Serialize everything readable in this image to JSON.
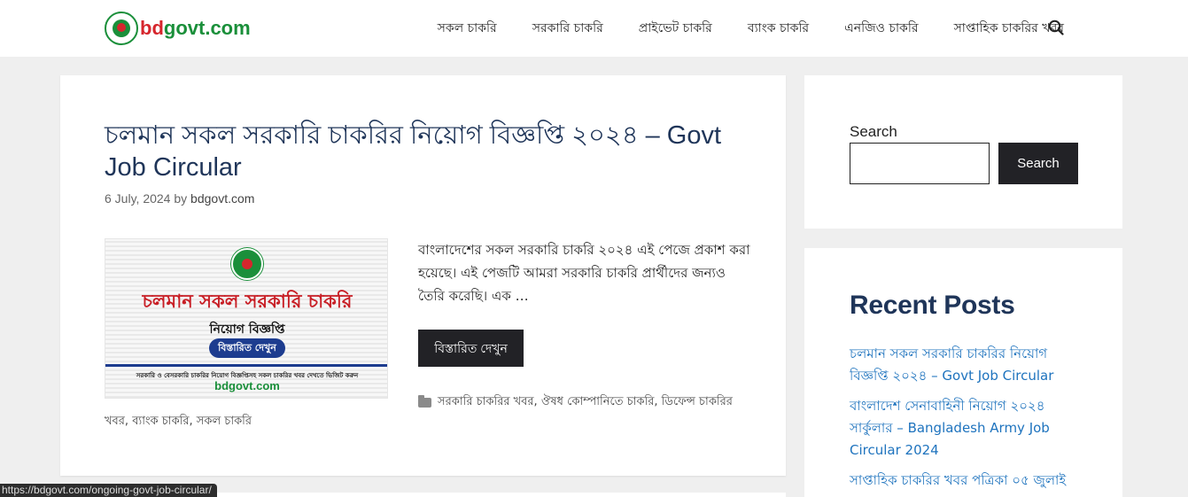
{
  "header": {
    "logo_text_a": "bd",
    "logo_text_b": "govt.com",
    "nav": [
      "সকল চাকরি",
      "সরকারি চাকরি",
      "প্রাইভেট চাকরি",
      "ব্যাংক চাকরি",
      "এনজিও চাকরি",
      "সাপ্তাহিক চাকরির খবর"
    ],
    "search_icon": "search-icon"
  },
  "post": {
    "title": "চলমান সকল সরকারি চাকরির নিয়োগ বিজ্ঞপ্তি ২০২৪ – Govt Job Circular",
    "date": "6 July, 2024",
    "by": "by",
    "author": "bdgovt.com",
    "thumbnail": {
      "title": "চলমান সকল সরকারি চাকরি",
      "subtitle": "নিয়োগ বিজ্ঞপ্তি",
      "button": "বিস্তারিত দেখুন",
      "footer": "সরকারি ও বেসরকারি চাকরির নিয়োগ বিজ্ঞপ্তিসহ সকল চাকরির খবর দেখতে ভিজিট করুন",
      "domain": "bdgovt.com"
    },
    "excerpt": "বাংলাদেশের সকল সরকারি চাকরি ২০২৪ এই পেজে প্রকাশ করা হয়েছে। এই পেজটি আমরা সরকারি চাকরি প্রার্থীদের জন্যও তৈরি করেছি। এক …",
    "read_more": "বিস্তারিত দেখুন",
    "categories_line1": "সরকারি চাকরির খবর, ঔষধ কোম্পানিতে চাকরি, ডিফেন্স চাকরির",
    "categories_line2": "খবর, ব্যাংক চাকরি, সকল চাকরি"
  },
  "sidebar": {
    "search_label": "Search",
    "search_button": "Search",
    "recent_title": "Recent Posts",
    "recent_posts": [
      "চলমান সকল সরকারি চাকরির নিয়োগ বিজ্ঞপ্তি ২০২৪ – Govt Job Circular",
      "বাংলাদেশ সেনাবাহিনী নিয়োগ ২০২৪ সার্কুলার – Bangladesh Army Job Circular 2024",
      "সাপ্তাহিক চাকরির খবর পত্রিকা ০৫ জুলাই"
    ]
  },
  "status_url": "https://bdgovt.com/ongoing-govt-job-circular/",
  "colors": {
    "title": "#1f3559",
    "link": "#1e73be",
    "button": "#222226",
    "brand_red": "#d6262d",
    "brand_green": "#1a8f3a"
  }
}
